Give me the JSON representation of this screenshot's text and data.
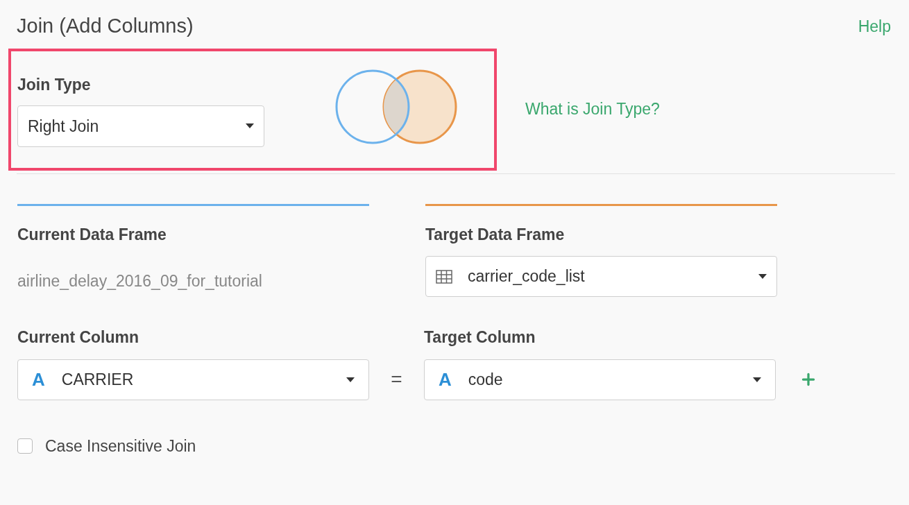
{
  "header": {
    "title": "Join (Add Columns)",
    "help_link": "Help"
  },
  "join_type": {
    "label": "Join Type",
    "value": "Right Join",
    "link": "What is Join Type?"
  },
  "current": {
    "label": "Current Data Frame",
    "value": "airline_delay_2016_09_for_tutorial"
  },
  "target": {
    "label": "Target Data Frame",
    "value": "carrier_code_list"
  },
  "current_column": {
    "label": "Current Column",
    "type_glyph": "A",
    "value": "CARRIER"
  },
  "equals": "=",
  "target_column": {
    "label": "Target Column",
    "type_glyph": "A",
    "value": "code"
  },
  "case_insensitive": {
    "label": "Case Insensitive Join",
    "checked": false
  }
}
